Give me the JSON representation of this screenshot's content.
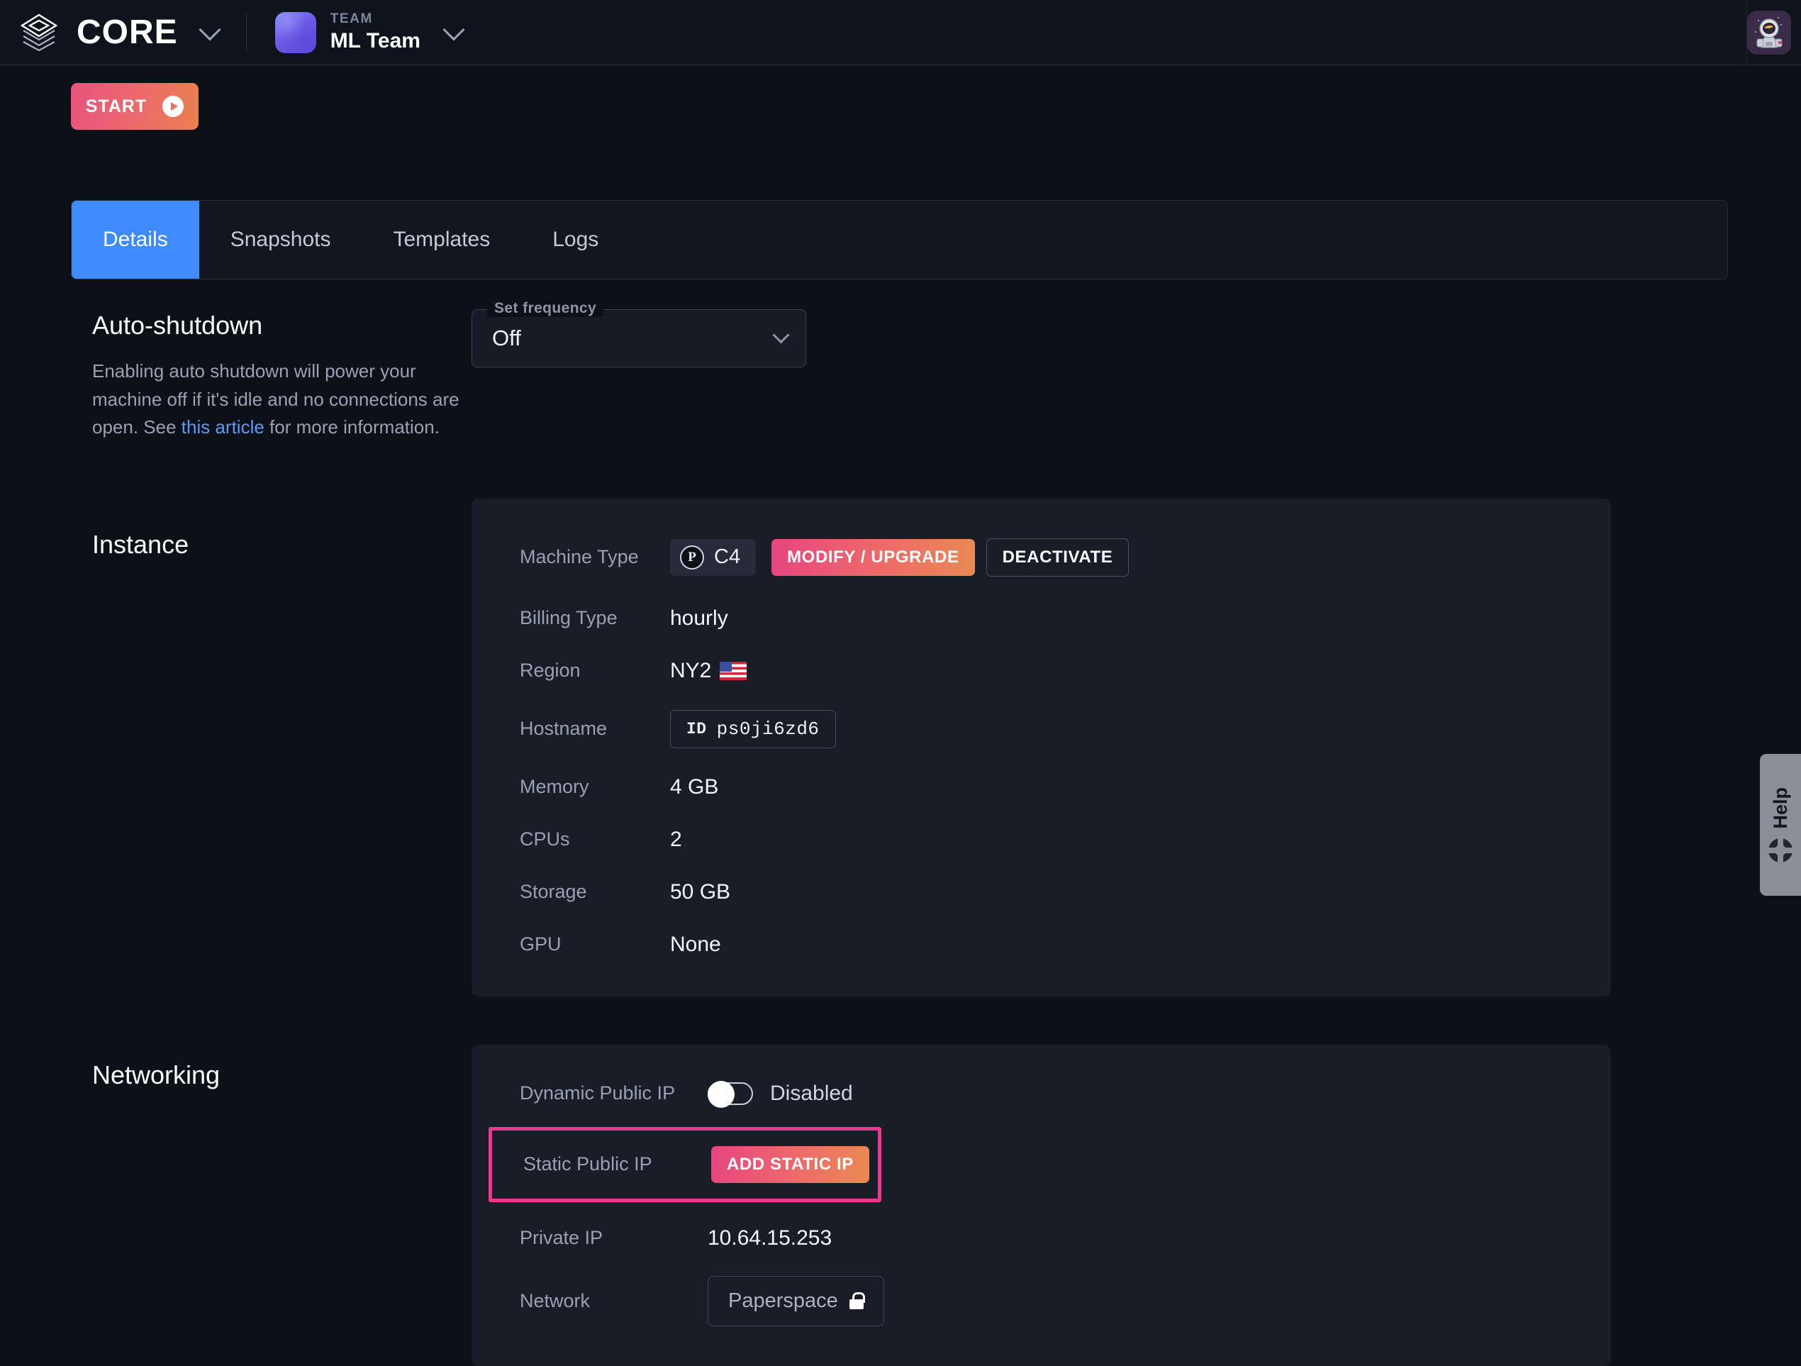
{
  "header": {
    "brand": "CORE",
    "brand_dropdown_icon": "chevron-down-icon",
    "team_label": "TEAM",
    "team_name": "ML Team",
    "team_dropdown_icon": "chevron-down-icon",
    "avatar_icon": "astronaut-avatar"
  },
  "toolbar": {
    "start_label": "START",
    "start_icon": "play-circle-icon"
  },
  "tabs": [
    {
      "label": "Details",
      "active": true
    },
    {
      "label": "Snapshots",
      "active": false
    },
    {
      "label": "Templates",
      "active": false
    },
    {
      "label": "Logs",
      "active": false
    }
  ],
  "auto_shutdown": {
    "title": "Auto-shutdown",
    "desc_part1": "Enabling auto shutdown will power your machine off if it's idle and no connections are open. See ",
    "link_text": "this article",
    "desc_part2": " for more information.",
    "frequency_legend": "Set frequency",
    "frequency_value": "Off",
    "frequency_icon": "chevron-down-icon"
  },
  "instance": {
    "title": "Instance",
    "machine_type_label": "Machine Type",
    "machine_type_badge": "P",
    "machine_type_value": "C4",
    "modify_label": "MODIFY / UPGRADE",
    "deactivate_label": "DEACTIVATE",
    "billing_label": "Billing Type",
    "billing_value": "hourly",
    "region_label": "Region",
    "region_value": "NY2",
    "region_flag_icon": "us-flag-icon",
    "hostname_label": "Hostname",
    "hostname_tag": "ID",
    "hostname_value": "ps0ji6zd6",
    "memory_label": "Memory",
    "memory_value": "4 GB",
    "cpus_label": "CPUs",
    "cpus_value": "2",
    "storage_label": "Storage",
    "storage_value": "50 GB",
    "gpu_label": "GPU",
    "gpu_value": "None"
  },
  "networking": {
    "title": "Networking",
    "dynamic_ip_label": "Dynamic Public IP",
    "dynamic_ip_state": "Disabled",
    "dynamic_ip_toggle_icon": "toggle-off-icon",
    "static_ip_label": "Static Public IP",
    "add_static_ip_label": "ADD STATIC IP",
    "private_ip_label": "Private IP",
    "private_ip_value": "10.64.15.253",
    "network_label": "Network",
    "network_value": "Paperspace",
    "network_lock_icon": "lock-icon"
  },
  "help": {
    "label": "Help",
    "icon": "lifebuoy-icon"
  },
  "colors": {
    "accent_blue": "#3d8bfd",
    "gradient_start": "#e8457f",
    "gradient_end": "#ea8a53",
    "highlight_pink": "#f2368f",
    "page_bg": "#0d1117",
    "panel_bg": "#181d28"
  }
}
